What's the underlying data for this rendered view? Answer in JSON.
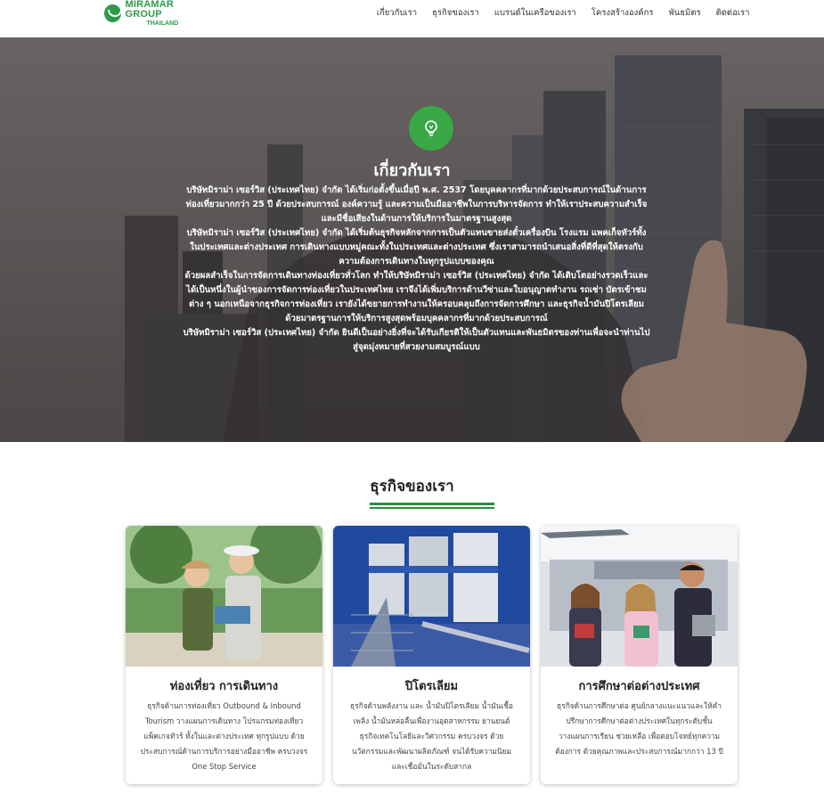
{
  "header": {
    "logo_main": "MIRAMAR GROUP",
    "logo_sub": "THAILAND",
    "nav": [
      "เกี่ยวกับเรา",
      "ธุรกิจของเรา",
      "แบรนด์ในเครือของเรา",
      "โครงสร้างองค์กร",
      "พันธมิตร",
      "ติดต่อเรา"
    ]
  },
  "hero": {
    "icon": "lightbulb-icon",
    "title": "เกี่ยวกับเรา",
    "paragraphs": [
      "บริษัทมิราม่า เซอร์วิส (ประเทศไทย) จำกัด ได้เริ่มก่อตั้งขึ้นเมื่อปี พ.ศ. 2537 โดยบุคคลากรที่มากด้วยประสบการณ์ในด้านการท่องเที่ยวมากกว่า 25 ปี ด้วยประสบการณ์ องค์ความรู้ และความเป็นมืออาชีพในการบริหารจัดการ ทำให้เราประสบความสำเร็จและมีชื่อเสียงในด้านการให้บริการในมาตรฐานสูงสุด",
      "บริษัทมิราม่า เซอร์วิส (ประเทศไทย) จำกัด ได้เริ่มต้นธุรกิจหลักจากการเป็นตัวแทนขายส่งตั๋วเครื่องบิน โรงแรม แพคเก็จทัวร์ทั้งในประเทศและต่างประเทศ การเดินทางแบบหมู่คณะทั้งในประเทศและต่างประเทศ ซึ่งเราสามารถนำเสนอสิ่งที่ดีที่สุดให้ตรงกับความต้องการเดินทางในทุกรูปแบบของคุณ",
      "ด้วยผลสำเร็จในการจัดการเดินทางท่องเที่ยวทั่วโลก ทำให้บริษัทมิราม่า เซอร์วิส (ประเทศไทย) จำกัด ได้เติบโตอย่างรวดเร็วและได้เป็นหนึ่งในผู้นำของการจัดการท่องเที่ยวในประเทศไทย เราจึงได้เพิ่มบริการด้านวีซ่าและใบอนุญาตทำงาน รถเช่า บัตรเข้าชมต่าง ๆ นอกเหนือจากธุรกิจการท่องเที่ยว เรายังได้ขยายการทำงานให้ครอบคลุมถึงการจัดการศึกษา และธุรกิจน้ำมันปิโตรเลียมด้วยมาตรฐานการให้บริการสูงสุดพร้อมบุคคลากรที่มากด้วยประสบการณ์",
      "บริษัทมิราม่า เซอร์วิส (ประเทศไทย) จำกัด ยินดีเป็นอย่างยิ่งที่จะได้รับเกียรติให้เป็นตัวแทนและพันธมิตรของท่านเพื่อจะนำท่านไปสู่จุดมุ่งหมายที่สวยงามสมบูรณ์แบบ"
    ]
  },
  "business": {
    "title": "ธุรกิจของเรา",
    "cards": [
      {
        "title": "ท่องเที่ยว การเดินทาง",
        "text": "ธุรกิจด้านการท่องเที่ยว Outbound & Inbound Tourism วางแผนการเดินทาง โปรแกรมท่องเที่ยว แพ็คเกจทัวร์ ทั้งในและต่างประเทศ ทุกรูปแบบ ด้วยประสบการณ์ด้านการบริการอย่างมืออาชีพ ครบวงจร One Stop Service"
      },
      {
        "title": "ปิโตรเลียม",
        "text": "ธุรกิจด้านพลังงาน และ น้ำมันปิโตรเลียม น้ำมันเชื้อเพลิง น้ำมันหล่อลื่นเพื่องานอุตสาหกรรม ยานยนต์ ธุรกิจเทคโนโลยีและวิศวกรรม ครบวงจร ด้วยนวัตกรรมและพัฒนาผลิตภัณฑ์ จนได้รับความนิยม และเชื่อมั่นในระดับสากล"
      },
      {
        "title": "การศึกษาต่อต่างประเทศ",
        "text": "ธุรกิจด้านการศึกษาต่อ ศูนย์กลางแนะแนวและให้คำปรึกษาการศึกษาต่อต่างประเทศในทุกระดับชั้น วางแผนการเรียน ช่วยเหลือ เพื่อตอบโจทย์ทุกความต้องการ ด้วยคุณภาพและประสบการณ์มากกว่า 13 ปี"
      }
    ]
  }
}
